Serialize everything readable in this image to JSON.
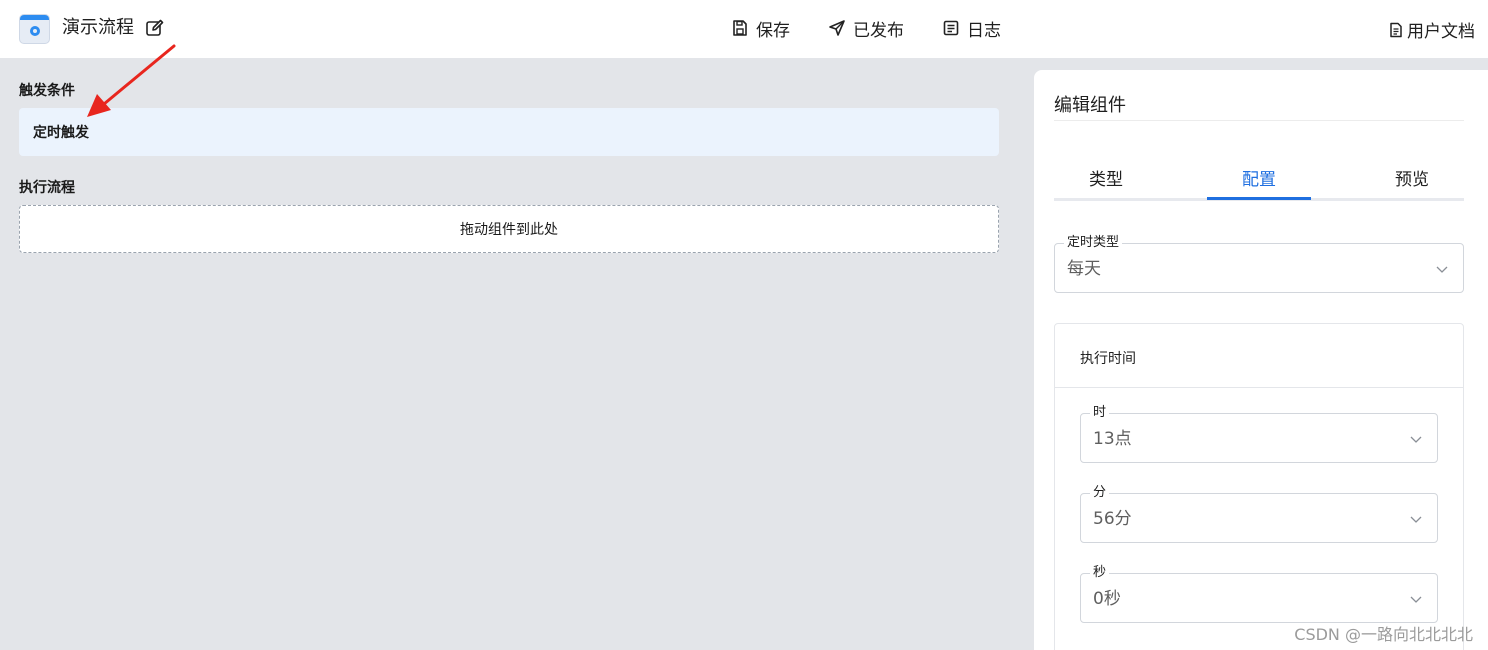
{
  "header": {
    "flow_title": "演示流程",
    "actions": {
      "save": "保存",
      "publish": "已发布",
      "logs": "日志"
    },
    "docs": "用户文档"
  },
  "canvas": {
    "trigger_section_label": "触发条件",
    "trigger_item": "定时触发",
    "flow_section_label": "执行流程",
    "drop_zone_text": "拖动组件到此处"
  },
  "panel": {
    "title": "编辑组件",
    "tabs": [
      "类型",
      "配置",
      "预览"
    ],
    "active_tab": "配置",
    "timer_type": {
      "label": "定时类型",
      "value": "每天"
    },
    "exec_time": {
      "title": "执行时间",
      "hour": {
        "label": "时",
        "value": "13点"
      },
      "minute": {
        "label": "分",
        "value": "56分"
      },
      "second": {
        "label": "秒",
        "value": "0秒"
      }
    }
  },
  "watermark": "CSDN @一路向北北北北",
  "colors": {
    "accent": "#1f6fe0",
    "canvas_bg": "#e3e5e9",
    "trigger_bg": "#ebf3fd",
    "annotation": "#e8261e"
  }
}
